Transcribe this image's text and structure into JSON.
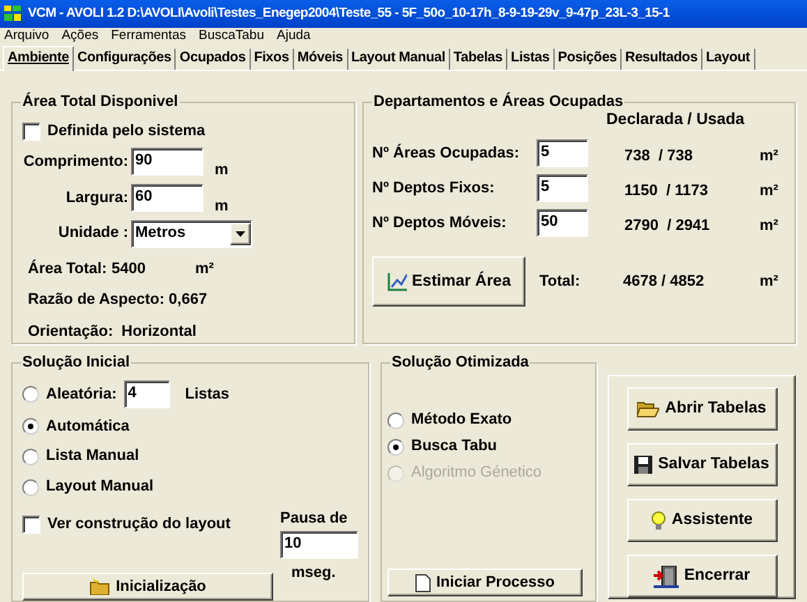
{
  "window": {
    "title": "VCM - AVOLI 1.2 D:\\AVOLI\\Avoli\\Testes_Enegep2004\\Teste_55 - 5F_50o_10-17h_8-9-19-29v_9-47p_23L-3_15-1"
  },
  "menu": [
    "Arquivo",
    "Ações",
    "Ferramentas",
    "BuscaTabu",
    "Ajuda"
  ],
  "tabs": [
    {
      "label": "Ambiente",
      "selected": true
    },
    {
      "label": "Configurações",
      "selected": false
    },
    {
      "label": "Ocupados",
      "selected": false
    },
    {
      "label": "Fixos",
      "selected": false
    },
    {
      "label": "Móveis",
      "selected": false
    },
    {
      "label": "Layout Manual",
      "selected": false
    },
    {
      "label": "Tabelas",
      "selected": false
    },
    {
      "label": "Listas",
      "selected": false
    },
    {
      "label": "Posições",
      "selected": false
    },
    {
      "label": "Resultados",
      "selected": false
    },
    {
      "label": "Layout",
      "selected": false
    }
  ],
  "area": {
    "title": "Área Total Disponivel",
    "auto": {
      "label": "Definida pelo sistema",
      "checked": false
    },
    "fields": [
      {
        "label": "Comprimento:",
        "value": "90",
        "unit": "m"
      },
      {
        "label": "Largura:",
        "value": "60",
        "unit": "m"
      }
    ],
    "unit_select": {
      "label": "Unidade :",
      "value": "Metros"
    },
    "total": {
      "label": "Área Total:",
      "value": "5400",
      "unit": "m²"
    },
    "ratio": "Razão de Aspecto: 0,667",
    "orientation": {
      "label": "Orientação:",
      "value": "Horizontal"
    }
  },
  "departments": {
    "title": "Departamentos e Áreas Ocupadas",
    "header": "Declarada  /  Usada",
    "rows": [
      {
        "label": "Nº Áreas Ocupadas:",
        "value": "5",
        "amount": "738  / 738",
        "unit": "m²"
      },
      {
        "label": "Nº Deptos Fixos:",
        "value": "5",
        "amount": "1150  / 1173",
        "unit": "m²"
      },
      {
        "label": "Nº Deptos Móveis:",
        "value": "50",
        "amount": "2790  / 2941",
        "unit": "m²"
      }
    ],
    "button": "Estimar Área",
    "total": {
      "label": "Total:",
      "amount": "4678 / 4852",
      "unit": "m²"
    }
  },
  "initial": {
    "title": "Solução Inicial",
    "options": [
      {
        "label": "Aleatória:",
        "selected": false,
        "value": "4",
        "suffix": "Listas"
      },
      {
        "label": "Automática",
        "selected": true
      },
      {
        "label": "Lista Manual",
        "selected": false
      },
      {
        "label": "Layout Manual",
        "selected": false
      }
    ],
    "show_build": {
      "label": "Ver construção do layout",
      "checked": false
    },
    "pause": {
      "label": "Pausa de",
      "value": "10",
      "unit": "mseg."
    },
    "button": "Inicialização"
  },
  "optimized": {
    "title": "Solução Otimizada",
    "options": [
      {
        "label": "Método Exato",
        "selected": false,
        "disabled": false
      },
      {
        "label": "Busca Tabu",
        "selected": true,
        "disabled": false
      },
      {
        "label": "Algoritmo Génetico",
        "selected": false,
        "disabled": true
      }
    ],
    "button": "Iniciar Processo"
  },
  "actions": [
    {
      "kind": "open",
      "label": "Abrir Tabelas"
    },
    {
      "kind": "save",
      "label": "Salvar Tabelas"
    },
    {
      "kind": "wizard",
      "label": "Assistente"
    },
    {
      "kind": "exit",
      "label": "Encerrar"
    }
  ]
}
